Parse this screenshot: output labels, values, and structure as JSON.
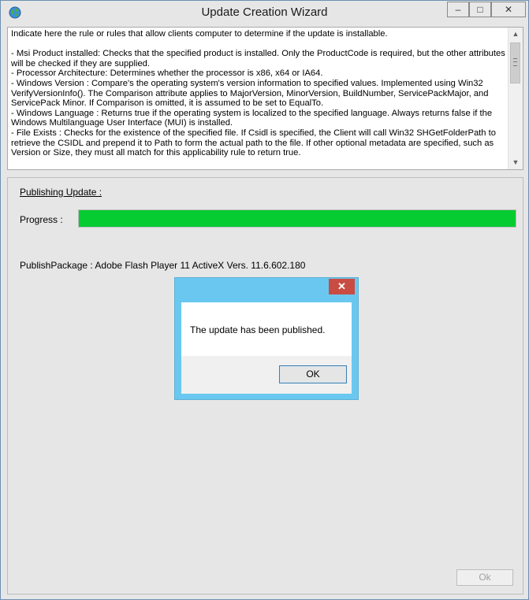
{
  "window": {
    "title": "Update Creation Wizard",
    "controls": {
      "minimize": "–",
      "maximize": "□",
      "close": "✕"
    }
  },
  "description": {
    "intro": "Indicate here the rule or rules that allow clients computer to determine if the update is installable.",
    "lines": [
      " - Msi Product installed: Checks that the specified product is installed. Only the ProductCode is required, but the other attributes will be checked if they are supplied.",
      " - Processor Architecture: Determines whether the processor is x86, x64 or IA64.",
      " - Windows Version : Compare's the operating system's version information to specified values.  Implemented using Win32 VerifyVersionInfo().  The Comparison attribute applies to MajorVersion, MinorVersion, BuildNumber, ServicePackMajor, and ServicePack Minor.  If Comparison is omitted, it is assumed to be set to EqualTo.",
      " - Windows Language : Returns true if the operating system is localized to the specified language.  Always returns false if the Windows Multilanguage User Interface (MUI) is installed.",
      " - File Exists : Checks for the existence of the specified file.  If Csidl is specified, the Client will call Win32 SHGetFolderPath to retrieve the CSIDL and prepend it to Path to form the actual path to the file. If other optional metadata are specified, such as Version or Size, they must all match for this applicability rule to return true."
    ]
  },
  "publishing": {
    "heading": "Publishing Update :",
    "progress_label": "Progress :",
    "progress_value": 1.0,
    "progress_color": "#06cb31",
    "package_text": "PublishPackage : Adobe Flash Player 11 ActiveX Vers. 11.6.602.180",
    "ok_label": "Ok"
  },
  "dialog": {
    "message": "The update has been published.",
    "ok_label": "OK",
    "close_glyph": "✕",
    "frame_color": "#6ac8f0"
  }
}
